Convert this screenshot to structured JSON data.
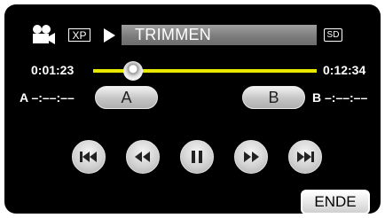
{
  "header": {
    "quality_badge": "XP",
    "mode_title": "TRIMMEN",
    "media_badge": "SD",
    "mode_icon": "video-camera-icon"
  },
  "timeline": {
    "current_time": "0:01:23",
    "total_time": "0:12:34",
    "progress_fraction": 0.18
  },
  "trim": {
    "a_label": "A",
    "a_time": "A –:––:––",
    "b_label": "B",
    "b_time": "B –:––:––"
  },
  "controls": [
    {
      "name": "skip-to-start",
      "icon": "skip-back-icon"
    },
    {
      "name": "rewind",
      "icon": "rewind-icon"
    },
    {
      "name": "pause",
      "icon": "pause-icon"
    },
    {
      "name": "fast-forward",
      "icon": "fast-forward-icon"
    },
    {
      "name": "skip-to-end",
      "icon": "skip-forward-icon"
    }
  ],
  "footer": {
    "end_label": "ENDE"
  },
  "colors": {
    "background": "#000000",
    "track": "#e8e800",
    "button_face": "#d0d0d0"
  }
}
